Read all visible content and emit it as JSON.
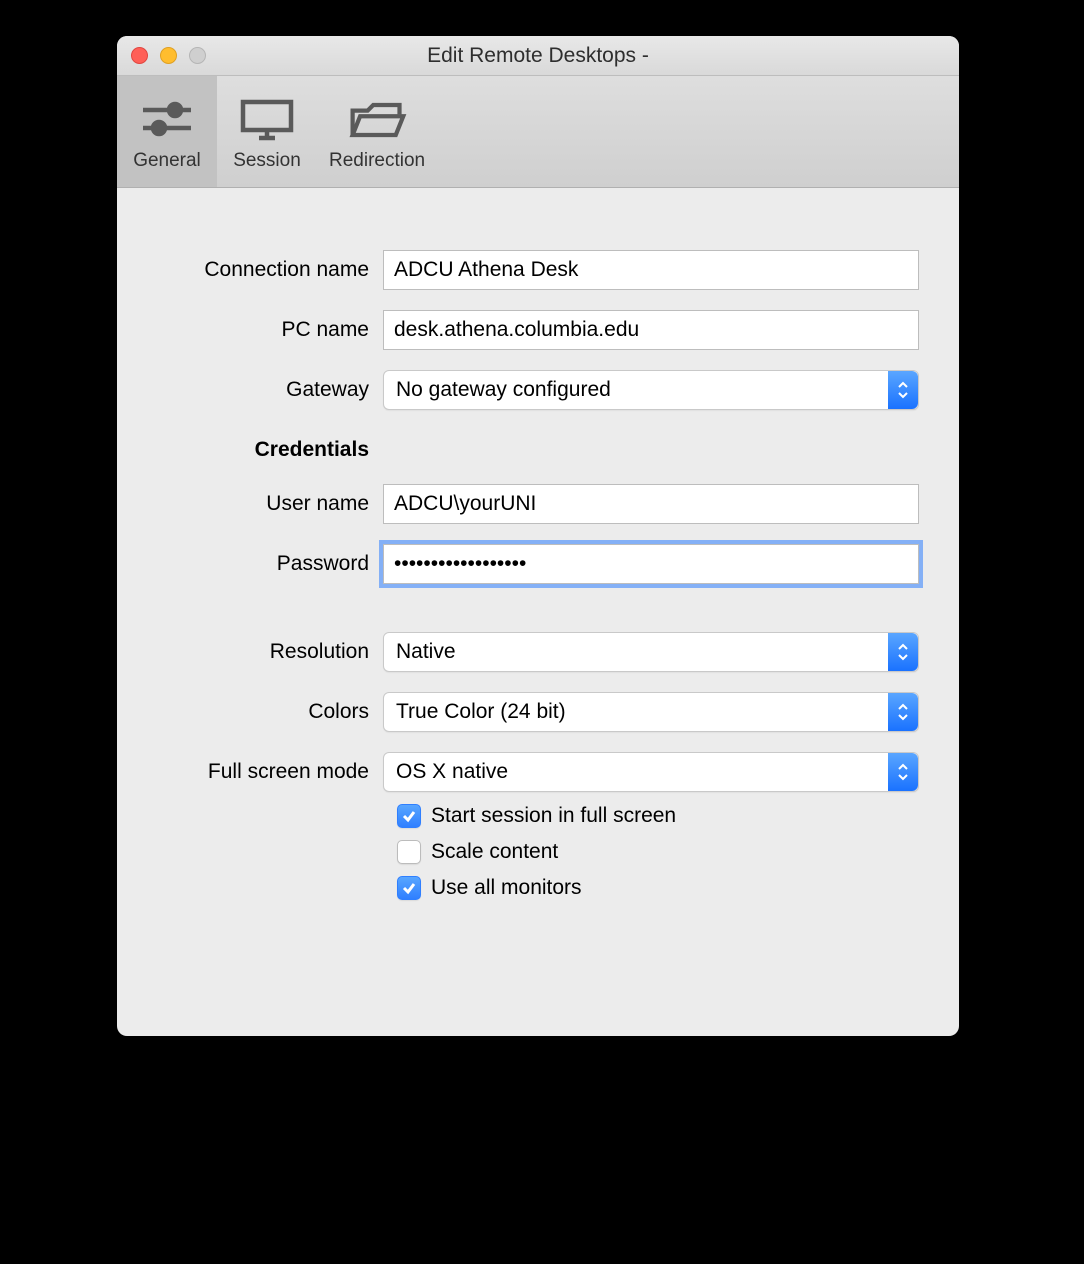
{
  "window": {
    "title": "Edit Remote Desktops -"
  },
  "tabs": {
    "general": "General",
    "session": "Session",
    "redirection": "Redirection"
  },
  "labels": {
    "connection_name": "Connection name",
    "pc_name": "PC name",
    "gateway": "Gateway",
    "credentials": "Credentials",
    "user_name": "User name",
    "password": "Password",
    "resolution": "Resolution",
    "colors": "Colors",
    "full_screen_mode": "Full screen mode"
  },
  "fields": {
    "connection_name": "ADCU Athena Desk",
    "pc_name": "desk.athena.columbia.edu",
    "gateway": "No gateway configured",
    "user_name": "ADCU\\yourUNI",
    "password": "••••••••••••••••••",
    "resolution": "Native",
    "colors": "True Color (24 bit)",
    "full_screen_mode": "OS X native"
  },
  "checkboxes": {
    "start_full_screen": {
      "label": "Start session in full screen",
      "checked": true
    },
    "scale_content": {
      "label": "Scale content",
      "checked": false
    },
    "use_all_monitors": {
      "label": "Use all monitors",
      "checked": true
    }
  }
}
